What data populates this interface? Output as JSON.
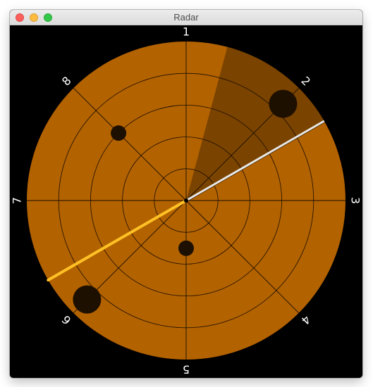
{
  "window": {
    "title": "Radar"
  },
  "radar": {
    "colors": {
      "background": "#000000",
      "disc": "#b36200",
      "sector": "#7a4300",
      "gridline": "#1a0e00",
      "blip": "#1e1000",
      "sweep": "#e8e8e8",
      "heading": "#ffc125",
      "label": "#ffffff"
    },
    "sector_bearing_deg": [
      15,
      60
    ],
    "sweep_bearing_deg": 60,
    "heading_bearing_deg": 240,
    "ring_count": 5,
    "labels": [
      {
        "text": "1",
        "bearing_deg": 0
      },
      {
        "text": "2",
        "bearing_deg": 45
      },
      {
        "text": "3",
        "bearing_deg": 90
      },
      {
        "text": "4",
        "bearing_deg": 135
      },
      {
        "text": "5",
        "bearing_deg": 180
      },
      {
        "text": "6",
        "bearing_deg": 225
      },
      {
        "text": "7",
        "bearing_deg": 270
      },
      {
        "text": "8",
        "bearing_deg": 315
      }
    ],
    "targets": [
      {
        "name": "target-northeast",
        "bearing_deg": 45,
        "range": 0.86,
        "size": "large"
      },
      {
        "name": "target-northwest",
        "bearing_deg": 315,
        "range": 0.6,
        "size": "small"
      },
      {
        "name": "target-south",
        "bearing_deg": 180,
        "range": 0.3,
        "size": "small"
      },
      {
        "name": "target-southwest",
        "bearing_deg": 225,
        "range": 0.88,
        "size": "large"
      }
    ]
  }
}
